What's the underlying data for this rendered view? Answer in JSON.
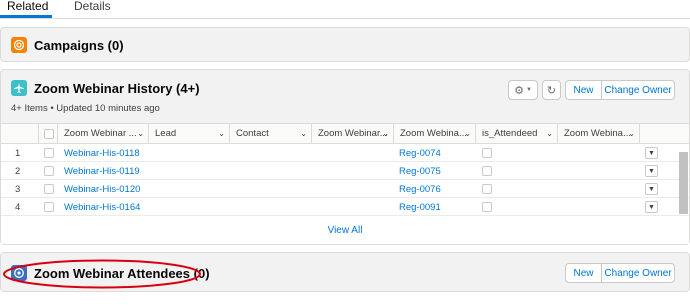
{
  "tabs": [
    {
      "label": "Related",
      "active": true
    },
    {
      "label": "Details",
      "active": false
    }
  ],
  "campaigns": {
    "title": "Campaigns (0)",
    "icon": "campaign-icon",
    "icon_color": "#f38303"
  },
  "history": {
    "title": "Zoom Webinar History (4+)",
    "subtitle": "4+ Items • Updated 10 minutes ago",
    "icon": "airplane-icon",
    "icon_color": "#3bbfc8",
    "buttons": {
      "new": "New",
      "change_owner": "Change Owner"
    },
    "columns": [
      "Zoom Webinar ...",
      "Lead",
      "Contact",
      "Zoom Webinar...",
      "Zoom Webina...",
      "is_Attendeed",
      "Zoom Webina..."
    ],
    "rows": [
      {
        "num": "1",
        "name": "Webinar-His-0118",
        "reg": "Reg-0074"
      },
      {
        "num": "2",
        "name": "Webinar-His-0119",
        "reg": "Reg-0075"
      },
      {
        "num": "3",
        "name": "Webinar-His-0120",
        "reg": "Reg-0076"
      },
      {
        "num": "4",
        "name": "Webinar-His-0164",
        "reg": "Reg-0091"
      }
    ],
    "view_all": "View All"
  },
  "attendees": {
    "title": "Zoom Webinar Attendees (0)",
    "icon": "attendee-icon",
    "icon_color": "#3a6fc4",
    "buttons": {
      "new": "New",
      "change_owner": "Change Owner"
    },
    "highlight_color": "#d7000f"
  },
  "colors": {
    "accent": "#0176d3",
    "border": "#dddbda"
  }
}
